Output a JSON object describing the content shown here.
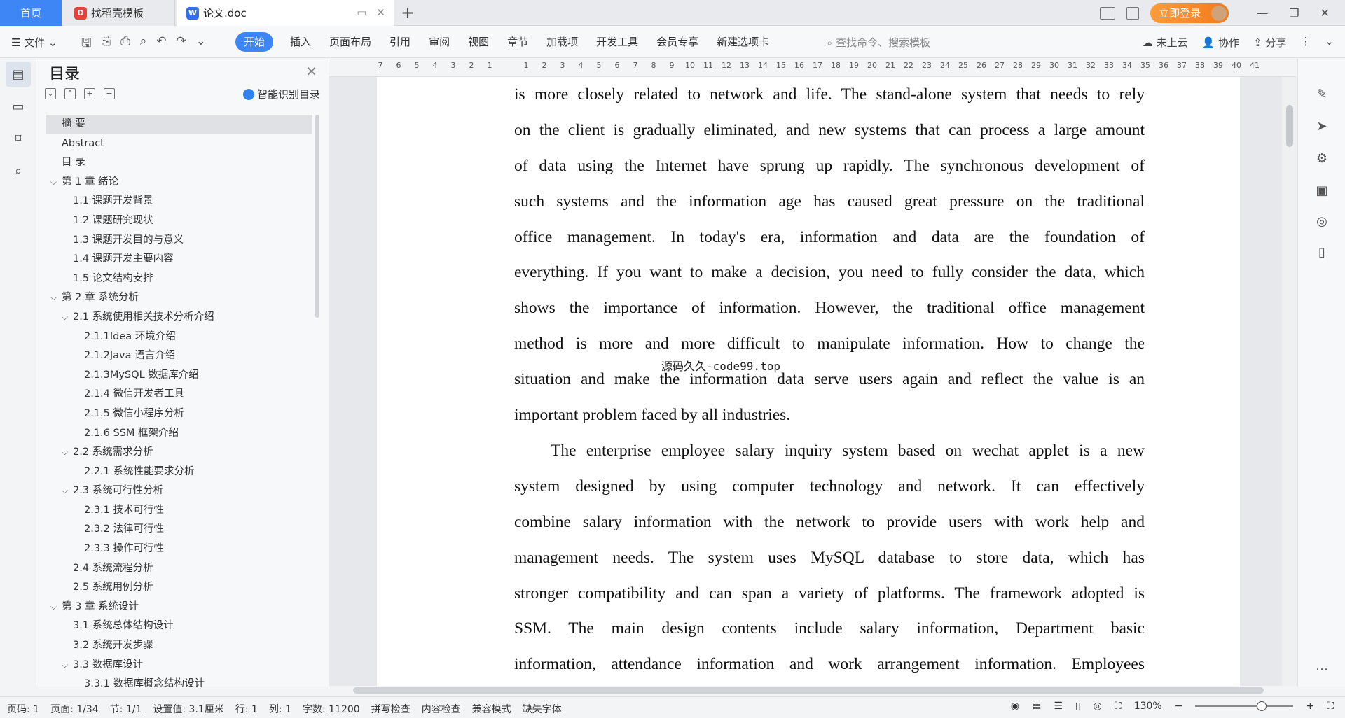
{
  "tabs": {
    "home": "首页",
    "template": "找稻壳模板",
    "doc": "论文.doc",
    "login": "立即登录"
  },
  "ribbon": {
    "file": "文件",
    "menus": [
      "开始",
      "插入",
      "页面布局",
      "引用",
      "审阅",
      "视图",
      "章节",
      "加载项",
      "开发工具",
      "会员专享",
      "新建选项卡"
    ],
    "search": "查找命令、搜索模板",
    "cloud": "未上云",
    "collab": "协作",
    "share": "分享"
  },
  "toc": {
    "title": "目录",
    "smart": "智能识别目录",
    "items": [
      {
        "label": "摘  要",
        "level": 1,
        "chev": false,
        "selected": true
      },
      {
        "label": "Abstract",
        "level": 1,
        "chev": false
      },
      {
        "label": "目  录",
        "level": 1,
        "chev": false
      },
      {
        "label": "第 1 章   绪论",
        "level": 1,
        "chev": true
      },
      {
        "label": "1.1 课题开发背景",
        "level": 2,
        "chev": false
      },
      {
        "label": "1.2 课题研究现状",
        "level": 2,
        "chev": false
      },
      {
        "label": "1.3 课题开发目的与意义",
        "level": 2,
        "chev": false
      },
      {
        "label": "1.4 课题开发主要内容",
        "level": 2,
        "chev": false
      },
      {
        "label": "1.5 论文结构安排",
        "level": 2,
        "chev": false
      },
      {
        "label": "第 2 章  系统分析",
        "level": 1,
        "chev": true
      },
      {
        "label": "2.1 系统使用相关技术分析介绍",
        "level": 2,
        "chev": true
      },
      {
        "label": "2.1.1Idea 环境介绍",
        "level": 3,
        "chev": false
      },
      {
        "label": "2.1.2Java 语言介绍",
        "level": 3,
        "chev": false
      },
      {
        "label": " 2.1.3MySQL 数据库介绍",
        "level": 3,
        "chev": false
      },
      {
        "label": "2.1.4 微信开发者工具",
        "level": 3,
        "chev": false
      },
      {
        "label": "2.1.5 微信小程序分析",
        "level": 3,
        "chev": false
      },
      {
        "label": "2.1.6 SSM 框架介绍",
        "level": 3,
        "chev": false
      },
      {
        "label": "2.2 系统需求分析",
        "level": 2,
        "chev": true
      },
      {
        "label": "2.2.1 系统性能要求分析",
        "level": 3,
        "chev": false
      },
      {
        "label": "2.3 系统可行性分析",
        "level": 2,
        "chev": true
      },
      {
        "label": "2.3.1 技术可行性",
        "level": 3,
        "chev": false
      },
      {
        "label": "2.3.2 法律可行性",
        "level": 3,
        "chev": false
      },
      {
        "label": "2.3.3 操作可行性",
        "level": 3,
        "chev": false
      },
      {
        "label": "2.4 系统流程分析",
        "level": 2,
        "chev": false
      },
      {
        "label": "2.5 系统用例分析",
        "level": 2,
        "chev": false
      },
      {
        "label": "第 3 章  系统设计",
        "level": 1,
        "chev": true
      },
      {
        "label": "3.1 系统总体结构设计",
        "level": 2,
        "chev": false
      },
      {
        "label": "3.2 系统开发步骤",
        "level": 2,
        "chev": false
      },
      {
        "label": "3.3 数据库设计",
        "level": 2,
        "chev": true
      },
      {
        "label": "3.3.1 数据库概念结构设计",
        "level": 3,
        "chev": false
      }
    ]
  },
  "ruler": [
    "7",
    "6",
    "5",
    "4",
    "3",
    "2",
    "1",
    "",
    "1",
    "2",
    "3",
    "4",
    "5",
    "6",
    "7",
    "8",
    "9",
    "10",
    "11",
    "12",
    "13",
    "14",
    "15",
    "16",
    "17",
    "18",
    "19",
    "20",
    "21",
    "22",
    "23",
    "24",
    "25",
    "26",
    "27",
    "28",
    "29",
    "30",
    "31",
    "32",
    "33",
    "34",
    "35",
    "36",
    "37",
    "38",
    "39",
    "40",
    "41"
  ],
  "doc": {
    "para1": [
      "is more closely related to network and life. The stand-alone system that needs to rely",
      "on the client is gradually eliminated, and new systems that can process a large amount",
      "of data using the Internet have sprung up rapidly. The synchronous development of",
      "such systems and the information age has caused great pressure on the traditional",
      "office management. In today's era, information and data are the foundation of",
      "everything. If you want to make a decision, you need to fully consider the data, which",
      "shows the importance of information. However, the traditional office management",
      "method is more and more difficult to manipulate information. How to change the",
      "situation and make the information data serve users again and reflect the value is an",
      "important problem faced by all industries."
    ],
    "para2": [
      "The enterprise employee salary inquiry system based on wechat applet is a new",
      "system designed by using computer technology and network. It can effectively",
      "combine salary information with the network to provide users with work help and",
      "management needs. The system uses MySQL database to store data, which has",
      "stronger compatibility and can span a variety of platforms. The framework adopted is",
      "SSM. The main design contents include salary information, Department basic",
      "information, attendance information and work arrangement information. Employees"
    ],
    "watermark": "源码久久-code99.top"
  },
  "status": {
    "items": [
      "页码: 1",
      "页面: 1/34",
      "节: 1/1",
      "设置值: 3.1厘米",
      "行: 1",
      "列: 1",
      "字数: 11200",
      "拼写检查",
      "内容检查",
      "兼容模式",
      "缺失字体"
    ],
    "zoom": "130%"
  }
}
